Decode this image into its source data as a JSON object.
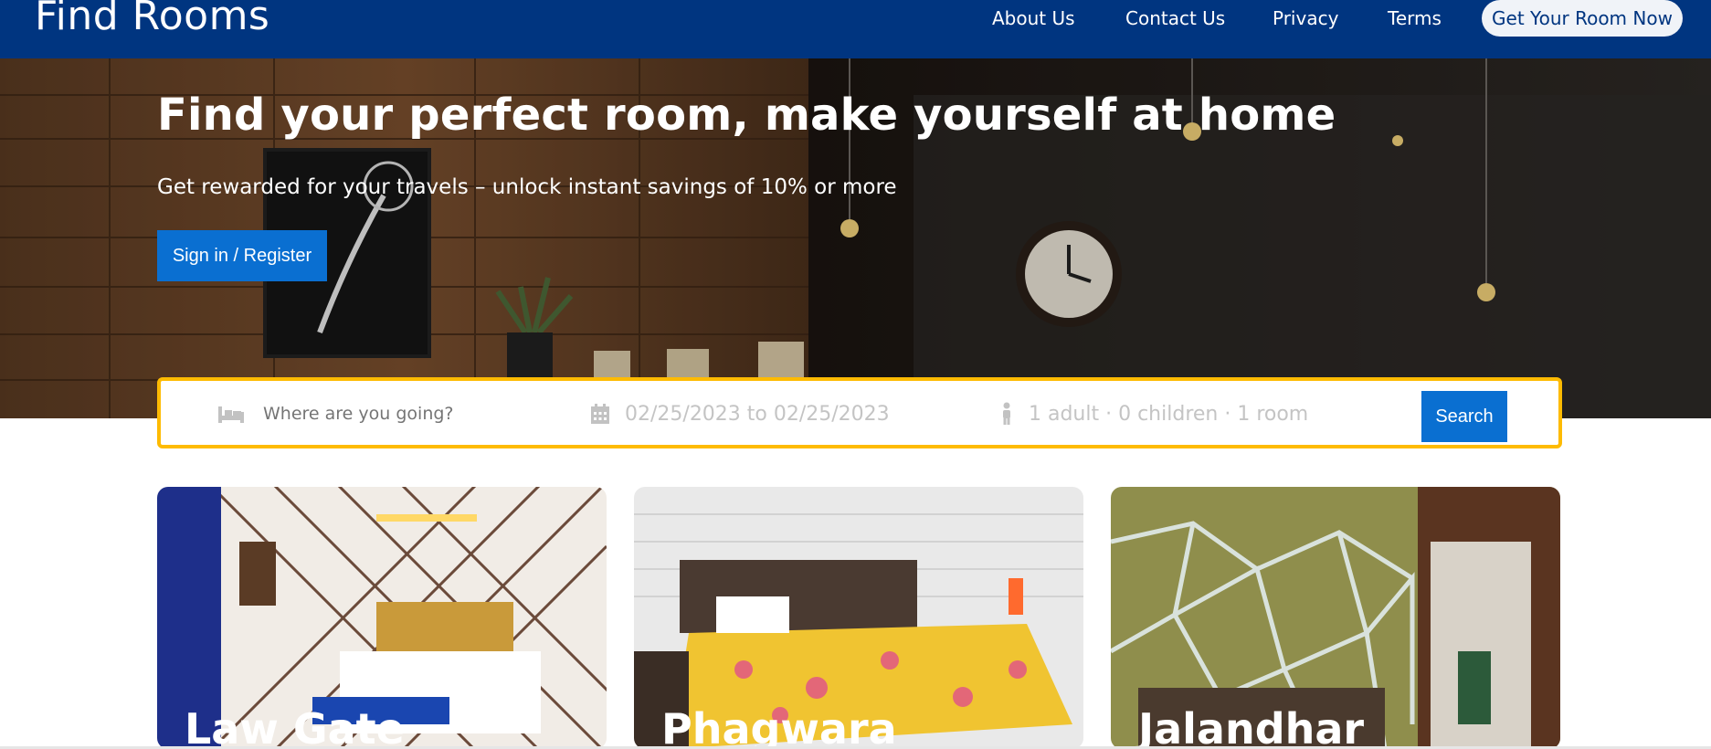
{
  "navbar": {
    "brand": "Find Rooms",
    "links": [
      "About Us",
      "Contact Us",
      "Privacy",
      "Terms"
    ],
    "cta": "Get Your Room Now"
  },
  "hero": {
    "title": "Find your perfect room, make yourself at home",
    "subtitle": "Get rewarded for your travels – unlock instant savings of 10% or more",
    "signin": "Sign in / Register"
  },
  "search": {
    "destination_placeholder": "Where are you going?",
    "dates": "02/25/2023 to 02/25/2023",
    "guests": "1 adult · 0 children · 1 room",
    "button": "Search"
  },
  "cards": [
    {
      "title": "Law Gate"
    },
    {
      "title": "Phagwara"
    },
    {
      "title": "Jalandhar"
    }
  ],
  "colors": {
    "brand_blue": "#003580",
    "button_blue": "#0a6fd1",
    "search_border": "#febb02"
  },
  "icons": [
    "bed-icon",
    "calendar-icon",
    "person-icon",
    "clock-icon",
    "lamp-icon",
    "plant-icon"
  ]
}
